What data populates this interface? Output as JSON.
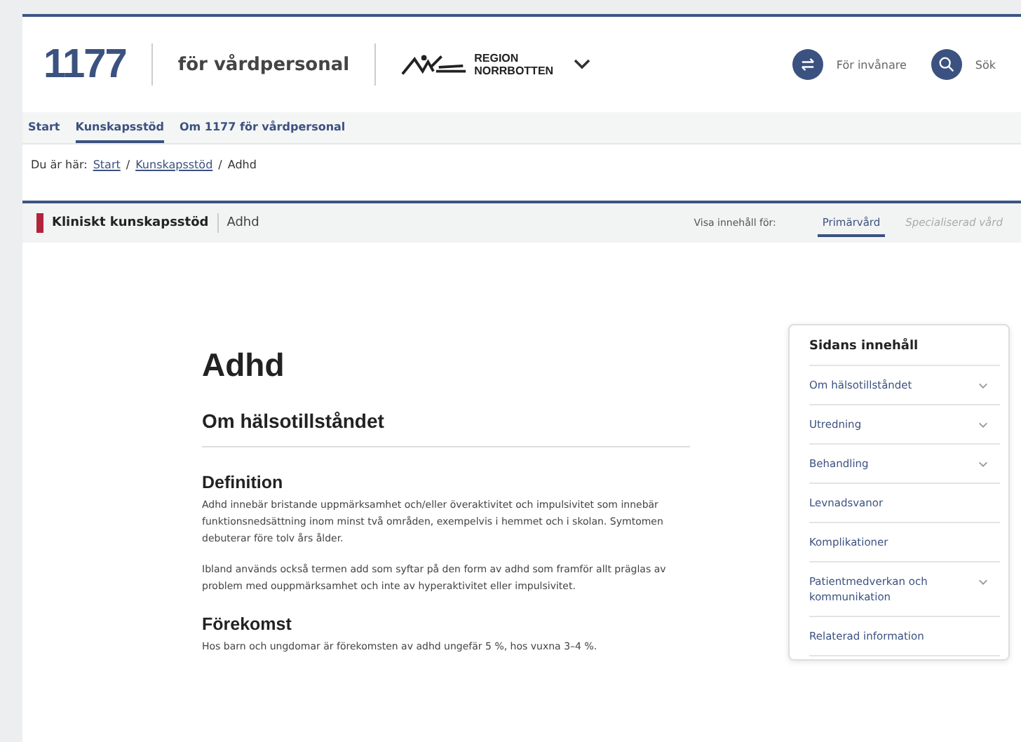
{
  "header": {
    "logo": "1177",
    "tagline": "för vårdpersonal",
    "region": [
      "REGION",
      "NORRBOTTEN"
    ],
    "actions": [
      {
        "kind": "switch",
        "label": "För invånare"
      },
      {
        "kind": "search",
        "label": "Sök"
      }
    ]
  },
  "nav": [
    {
      "label": "Start",
      "selected": false
    },
    {
      "label": "Kunskapsstöd",
      "selected": true
    },
    {
      "label": "Om 1177 för vårdpersonal",
      "selected": false
    }
  ],
  "breadcrumb": {
    "prefix": "Du är här:",
    "links": [
      "Start",
      "Kunskapsstöd"
    ],
    "separator": "/",
    "current": "Adhd"
  },
  "subheader": {
    "section": "Kliniskt kunskapsstöd",
    "page": "Adhd",
    "filter_label": "Visa innehåll för:",
    "options": [
      {
        "label": "Primärvård",
        "selected": true
      },
      {
        "label": "Specialiserad vård",
        "selected": false
      }
    ]
  },
  "article": {
    "title": "Adhd",
    "section_title": "Om hälsotillståndet",
    "subsections": [
      {
        "heading": "Definition",
        "paragraphs": [
          "Adhd innebär bristande uppmärksamhet och/eller överaktivitet och impulsivitet som innebär funktionsnedsättning inom minst två områden, exempelvis i hemmet och i skolan. Symtomen debuterar före tolv års ålder.",
          "Ibland används också termen add som syftar på den form av adhd som framför allt präglas av problem med ouppmärksamhet och inte av hyperaktivitet eller impulsivitet."
        ]
      },
      {
        "heading": "Förekomst",
        "paragraphs": [
          "Hos barn och ungdomar är förekomsten av adhd ungefär 5 %, hos vuxna 3–4 %."
        ]
      }
    ]
  },
  "toc": {
    "title": "Sidans innehåll",
    "items": [
      {
        "label": "Om hälsotillståndet",
        "expandable": true
      },
      {
        "label": "Utredning",
        "expandable": true
      },
      {
        "label": "Behandling",
        "expandable": true
      },
      {
        "label": "Levnadsvanor",
        "expandable": false
      },
      {
        "label": "Komplikationer",
        "expandable": false
      },
      {
        "label": "Patientmedverkan och kommunikation",
        "expandable": true
      },
      {
        "label": "Relaterad information",
        "expandable": false
      }
    ]
  }
}
